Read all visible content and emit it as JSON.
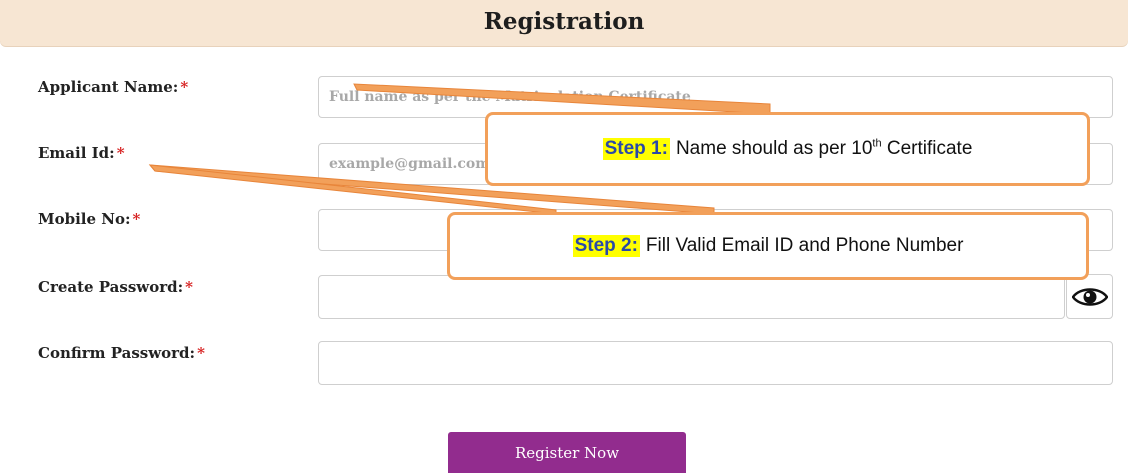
{
  "header": {
    "title": "Registration"
  },
  "form": {
    "required_marker": "*",
    "fields": [
      {
        "label": "Applicant Name:",
        "placeholder": "Full name as per the Matriculation Certificate",
        "value": ""
      },
      {
        "label": "Email Id:",
        "placeholder": "example@gmail.com",
        "value": ""
      },
      {
        "label": "Mobile No:",
        "placeholder": "",
        "value": ""
      },
      {
        "label": "Create Password:",
        "placeholder": "",
        "value": ""
      },
      {
        "label": "Confirm Password:",
        "placeholder": "",
        "value": ""
      }
    ],
    "submit_label": "Register Now"
  },
  "annotations": {
    "step1": {
      "step_label": "Step 1:",
      "text_before": "Name should as per 10",
      "sup": "th",
      "text_after": " Certificate"
    },
    "step2": {
      "step_label": "Step 2:",
      "text": "Fill Valid Email ID and Phone Number"
    }
  },
  "colors": {
    "header_bg": "#f7e6d3",
    "required": "#d61f1f",
    "button_bg": "#922c8e",
    "callout_border": "#f2a05a",
    "step_highlight": "#ffff00"
  }
}
